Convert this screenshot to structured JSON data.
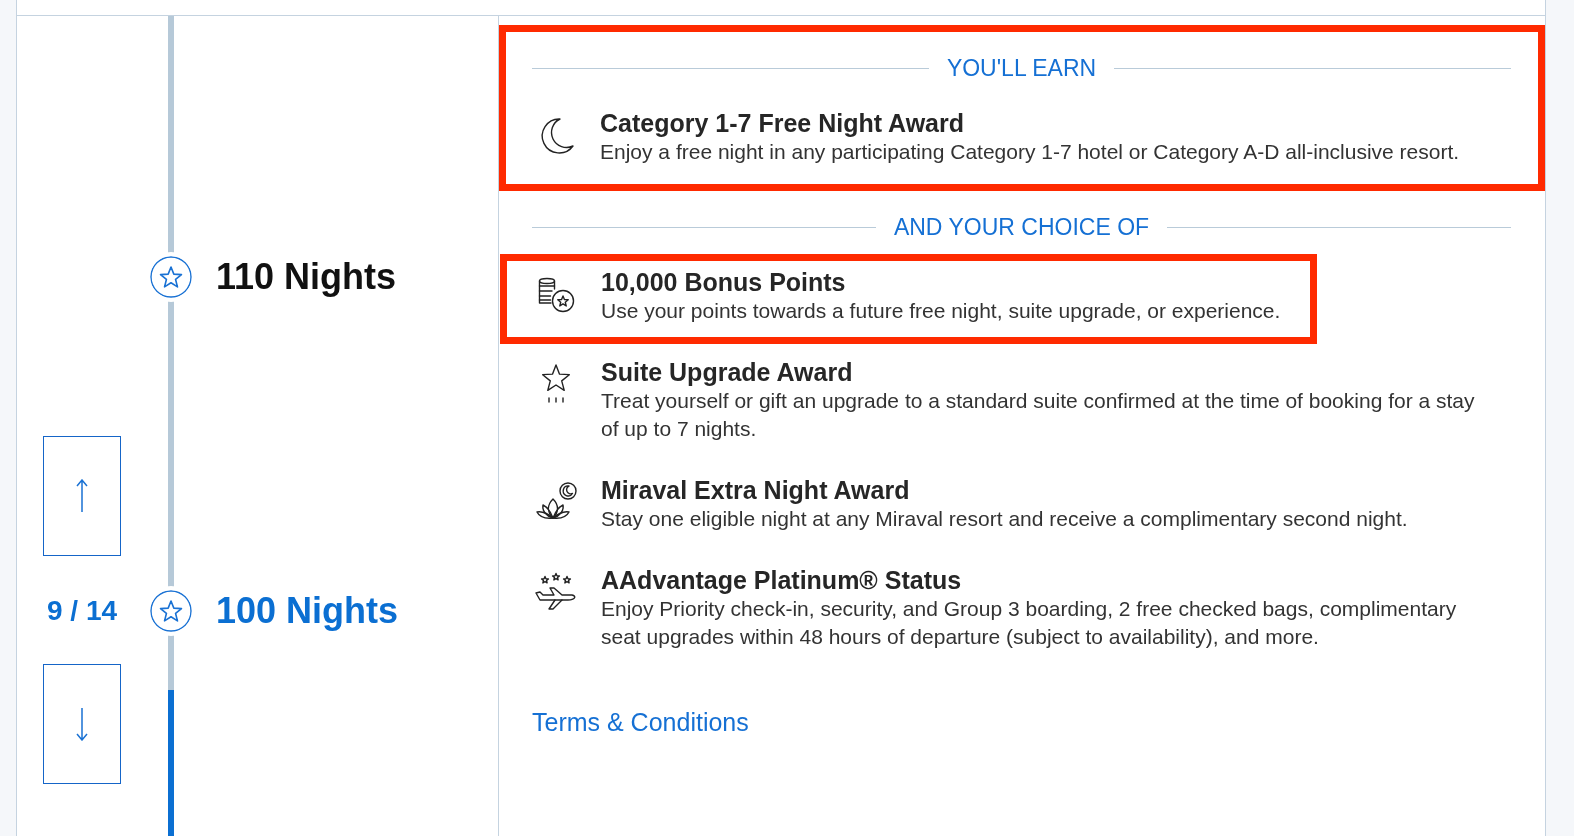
{
  "timeline": {
    "counter": "9 / 14",
    "milestones": [
      {
        "label": "110 Nights",
        "selected": false
      },
      {
        "label": "100 Nights",
        "selected": true
      }
    ]
  },
  "earn": {
    "heading": "YOU'LL EARN",
    "highlighted": true,
    "award": {
      "kind": "free_night",
      "title": "Category 1-7 Free Night Award",
      "description": "Enjoy a free night in any participating Category 1-7 hotel or Category A-D all-inclusive resort."
    }
  },
  "choice": {
    "heading": "AND YOUR CHOICE OF",
    "options": [
      {
        "kind": "points",
        "title": "10,000 Bonus Points",
        "description": "Use your points towards a future free night, suite upgrade, or experience.",
        "highlighted": true
      },
      {
        "kind": "suite",
        "title": "Suite Upgrade Award",
        "description": "Treat yourself or gift an upgrade to a standard suite confirmed at the time of booking for a stay of up to 7 nights.",
        "highlighted": false
      },
      {
        "kind": "miraval",
        "title": "Miraval Extra Night Award",
        "description": "Stay one eligible night at any Miraval resort and receive a complimentary second night.",
        "highlighted": false
      },
      {
        "kind": "status",
        "title": "AAdvantage Platinum® Status",
        "description": "Enjoy Priority check-in, security, and Group 3 boarding, 2 free checked bags, complimentary seat upgrades within 48 hours of departure (subject to availability), and more.",
        "highlighted": false
      }
    ]
  },
  "terms_link": "Terms & Conditions"
}
